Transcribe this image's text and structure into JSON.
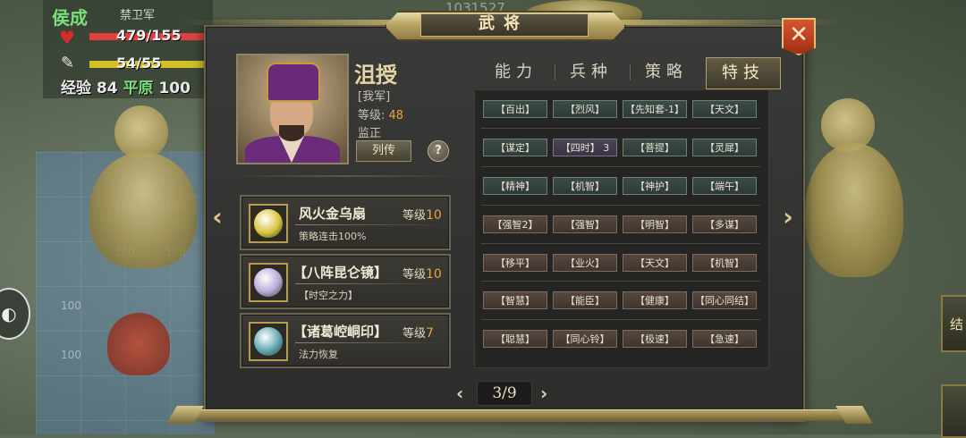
{
  "background": {
    "hud": {
      "name": "侯成",
      "subtitle": "禁卫军",
      "hp": "479/155",
      "hp_ratio": 1.0,
      "mp": "54/55",
      "mp_ratio": 0.98,
      "exp_label": "经验",
      "exp_value": "84",
      "terrain": "平原",
      "terrain_value": "100"
    },
    "top_number": "1031527",
    "tile_value": "100",
    "right_tab_label": "结"
  },
  "dialog": {
    "title": "武将",
    "general": {
      "name": "沮授",
      "faction": "[我军]",
      "level_label": "等级:",
      "level": "48",
      "title": "监正",
      "biography_button": "列传",
      "help_button": "?"
    },
    "tabs": [
      {
        "label": "能力",
        "active": false
      },
      {
        "label": "兵种",
        "active": false
      },
      {
        "label": "策略",
        "active": false
      },
      {
        "label": "特技",
        "active": true
      }
    ],
    "equipment": [
      {
        "name": "风火金乌扇",
        "level_label": "等级",
        "level": "10",
        "desc": "策略连击100%",
        "icon": "fan-icon",
        "color": "#d8c33a"
      },
      {
        "name": "【八阵昆仑镜】",
        "level_label": "等级",
        "level": "10",
        "desc": "【时空之力】",
        "icon": "mirror-icon",
        "color": "#b9a7d6"
      },
      {
        "name": "【诸葛崆峒印】",
        "level_label": "等级",
        "level": "7",
        "desc": "法力恢复",
        "icon": "seal-icon",
        "color": "#5fa7b0"
      }
    ],
    "skills": [
      [
        {
          "label": "【百出】",
          "tone": "teal"
        },
        {
          "label": "【烈风】",
          "tone": "teal"
        },
        {
          "label": "【先知套-1】",
          "tone": "teal"
        },
        {
          "label": "【天文】",
          "tone": "teal"
        }
      ],
      [
        {
          "label": "【谋定】",
          "tone": "teal"
        },
        {
          "label": "【四时】 3",
          "tone": "purple"
        },
        {
          "label": "【菩提】",
          "tone": "teal"
        },
        {
          "label": "【灵犀】",
          "tone": "teal"
        }
      ],
      [
        {
          "label": "【精神】",
          "tone": "teal"
        },
        {
          "label": "【机智】",
          "tone": "teal"
        },
        {
          "label": "【神护】",
          "tone": "teal"
        },
        {
          "label": "【端午】",
          "tone": "teal"
        }
      ],
      [
        {
          "label": "【强智2】",
          "tone": "brown"
        },
        {
          "label": "【强智】",
          "tone": "brown"
        },
        {
          "label": "【明智】",
          "tone": "brown"
        },
        {
          "label": "【多谋】",
          "tone": "brown"
        }
      ],
      [
        {
          "label": "【移平】",
          "tone": "brown"
        },
        {
          "label": "【业火】",
          "tone": "brown"
        },
        {
          "label": "【天文】",
          "tone": "brown"
        },
        {
          "label": "【机智】",
          "tone": "brown"
        }
      ],
      [
        {
          "label": "【智慧】",
          "tone": "brown"
        },
        {
          "label": "【能臣】",
          "tone": "brown"
        },
        {
          "label": "【健康】",
          "tone": "brown"
        },
        {
          "label": "【同心同结】",
          "tone": "brown"
        }
      ],
      [
        {
          "label": "【聪慧】",
          "tone": "brown"
        },
        {
          "label": "【同心铃】",
          "tone": "brown"
        },
        {
          "label": "【极速】",
          "tone": "brown"
        },
        {
          "label": "【急速】",
          "tone": "brown"
        }
      ]
    ],
    "pagination": {
      "current": "3/9",
      "prev": "‹",
      "next": "›"
    },
    "nav": {
      "left": "‹",
      "right": "›"
    },
    "close": "✕"
  },
  "colors": {
    "gold": "#c9b272",
    "level_orange": "#e8a542",
    "hp_red": "#e04040",
    "mp_yellow": "#d2c02a"
  }
}
